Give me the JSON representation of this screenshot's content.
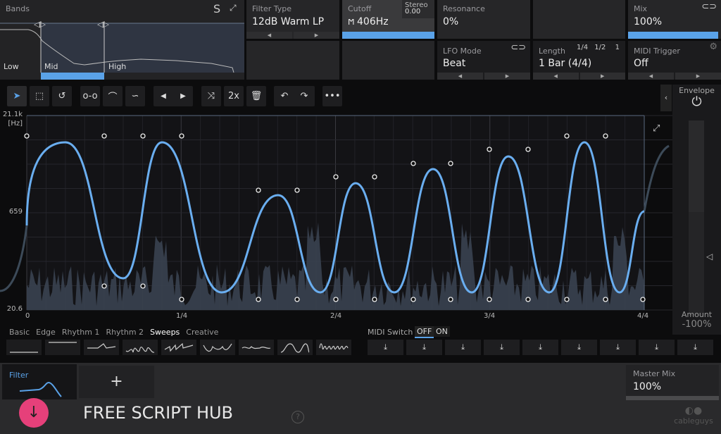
{
  "bands": {
    "title": "Bands",
    "solo": "S",
    "labels": [
      "Low",
      "Mid",
      "High"
    ]
  },
  "params": {
    "filter_type": {
      "label": "Filter Type",
      "value": "12dB Warm LP"
    },
    "cutoff": {
      "label": "Cutoff",
      "value": "406Hz",
      "stereo_label": "Stereo",
      "stereo_value": "0.00"
    },
    "resonance": {
      "label": "Resonance",
      "value": "0%"
    },
    "mix": {
      "label": "Mix",
      "value": "100%",
      "fill": 0.97
    },
    "lfo_mode": {
      "label": "LFO Mode",
      "value": "Beat"
    },
    "length": {
      "label": "Length",
      "value": "1 Bar (4/4)",
      "quick": [
        "1/4",
        "1/2",
        "1"
      ]
    },
    "midi_trigger": {
      "label": "MIDI Trigger",
      "value": "Off"
    }
  },
  "toolbar": {
    "double": "2x"
  },
  "graph": {
    "y_top": "21.1k",
    "y_unit": "[Hz]",
    "y_mid": "659",
    "y_bottom": "20.6",
    "x_ticks": [
      "0",
      "1/4",
      "2/4",
      "3/4",
      "4/4"
    ]
  },
  "envelope": {
    "title": "Envelope",
    "amount_label": "Amount",
    "amount_value": "-100%"
  },
  "presets": {
    "tabs": [
      "Basic",
      "Edge",
      "Rhythm 1",
      "Rhythm 2",
      "Sweeps",
      "Creative"
    ],
    "active": "Sweeps"
  },
  "midi_switch": {
    "label": "MIDI Switch",
    "off": "OFF",
    "on": "ON",
    "active": "OFF"
  },
  "bottom": {
    "filter_tab": "Filter",
    "add": "+",
    "master_mix_label": "Master Mix",
    "master_mix_value": "100%",
    "brand": "cableguys",
    "watermark": "FREE SCRIPT HUB"
  },
  "colors": {
    "accent": "#5aa2e8",
    "background": "#0c0c0d",
    "panel": "#262628"
  }
}
